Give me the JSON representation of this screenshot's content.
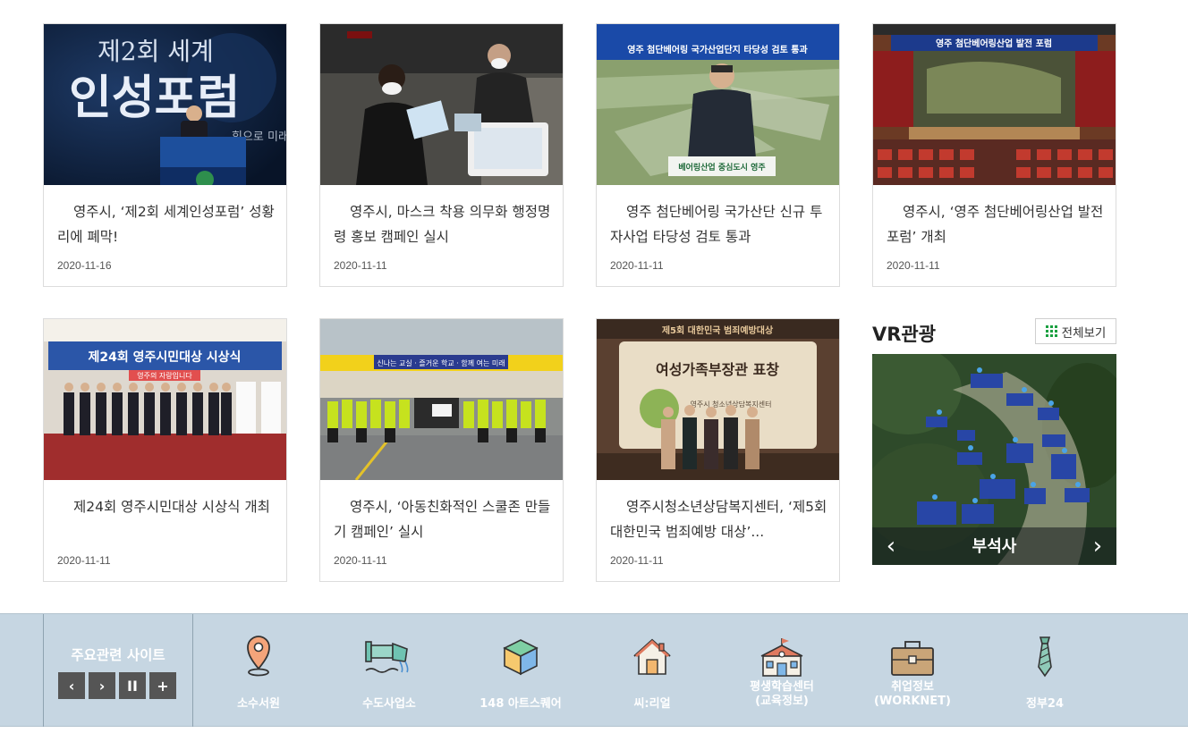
{
  "news": [
    {
      "title": "영주시, ‘제2회 세계인성포럼’ 성황리에 폐막!",
      "date": "2020-11-16"
    },
    {
      "title": "영주시, 마스크 착용 의무화 행정명령 홍보 캠페인 실시",
      "date": "2020-11-11"
    },
    {
      "title": "영주 첨단베어링 국가산단 신규 투자사업 타당성 검토 통과",
      "date": "2020-11-11"
    },
    {
      "title": "영주시, ‘영주 첨단베어링산업 발전 포럼’ 개최",
      "date": "2020-11-11"
    },
    {
      "title": "제24회 영주시민대상 시상식 개최",
      "date": "2020-11-11"
    },
    {
      "title": "영주시, ‘아동친화적인 스쿨존 만들기 캠페인’ 실시",
      "date": "2020-11-11"
    },
    {
      "title": "영주시청소년상담복지센터, ‘제5회 대한민국 범죄예방 대상’...",
      "date": "2020-11-11"
    }
  ],
  "photo_text": {
    "p1": {
      "t1": "제2회 세계",
      "t2": "인성포럼",
      "t3": "힘으로 미래"
    },
    "p3": {
      "banner": "영주 첨단베어링 국가산업단지 타당성 검토 통과",
      "sign": "베어링산업 중심도시 영주"
    },
    "p4": {
      "banner": "영주 첨단베어링산업 발전 포럼"
    },
    "p5": {
      "banner": "제24회 영주시민대상 시상식",
      "sub": "영주의 자랑입니다"
    },
    "p6": {
      "banner": "신나는 교실 · 즐거운 학교 · 함께 여는 미래"
    },
    "p7": {
      "banner": "제5회 대한민국 범죄예방대상",
      "board": "여성가족부장관 표창",
      "org": "영주시 청소년상담복지센터"
    }
  },
  "vr": {
    "title": "VR관광",
    "more": "전체보기",
    "caption": "부석사"
  },
  "footer": {
    "heading": "주요관련 사이트",
    "controls": [
      "‹",
      "›",
      "II",
      "+"
    ],
    "sites": [
      {
        "icon": "map-pin-icon",
        "line1": "소수서원",
        "line2": ""
      },
      {
        "icon": "water-pipe-icon",
        "line1": "수도사업소",
        "line2": ""
      },
      {
        "icon": "cube-icon",
        "line1": "148 아트스퀘어",
        "line2": ""
      },
      {
        "icon": "house-icon",
        "line1": "씨:리얼",
        "line2": ""
      },
      {
        "icon": "school-icon",
        "line1": "평생학습센터",
        "line2": "(교육정보)"
      },
      {
        "icon": "briefcase-icon",
        "line1": "취업정보",
        "line2": "(WORKNET)"
      },
      {
        "icon": "necktie-icon",
        "line1": "정부24",
        "line2": ""
      }
    ]
  },
  "colors": {
    "footer_bg": "#c6d6e2",
    "control_bg": "#555555",
    "grid_icon": "#1aa040"
  }
}
